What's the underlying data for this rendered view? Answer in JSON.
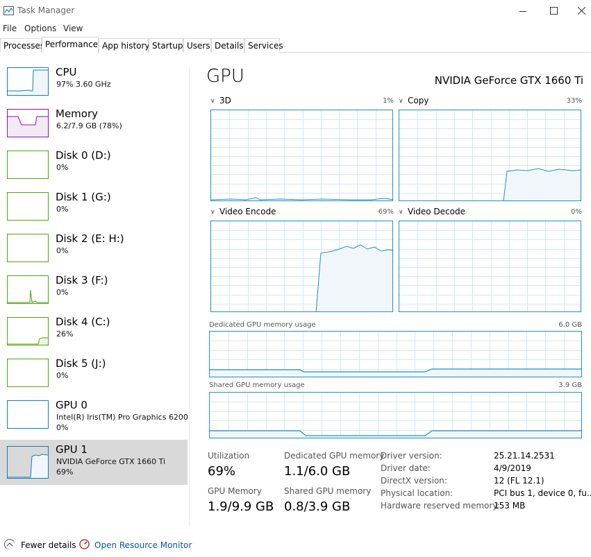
{
  "window": {
    "title": "Task Manager",
    "controls": {
      "minimize": "minimize",
      "maximize": "maximize",
      "close": "close"
    }
  },
  "menu": [
    "File",
    "Options",
    "View"
  ],
  "tabs": [
    "Processes",
    "Performance",
    "App history",
    "Startup",
    "Users",
    "Details",
    "Services"
  ],
  "active_tab": "Performance",
  "sidebar": [
    {
      "title": "CPU",
      "sub1": "97%  3.60 GHz",
      "sub2": "",
      "color": "#117dbb",
      "fill": "#f1f6fa"
    },
    {
      "title": "Memory",
      "sub1": "6.2/7.9 GB (78%)",
      "sub2": "",
      "color": "#8b12ae",
      "fill": "#f4eaf6"
    },
    {
      "title": "Disk 0 (D:)",
      "sub1": "0%",
      "sub2": "",
      "color": "#4da60c",
      "fill": "#eff7e6"
    },
    {
      "title": "Disk 1 (G:)",
      "sub1": "0%",
      "sub2": "",
      "color": "#4da60c",
      "fill": "#eff7e6"
    },
    {
      "title": "Disk 2 (E: H:)",
      "sub1": "0%",
      "sub2": "",
      "color": "#4da60c",
      "fill": "#eff7e6"
    },
    {
      "title": "Disk 3 (F:)",
      "sub1": "0%",
      "sub2": "",
      "color": "#4da60c",
      "fill": "#eff7e6"
    },
    {
      "title": "Disk 4 (C:)",
      "sub1": "26%",
      "sub2": "",
      "color": "#4da60c",
      "fill": "#eff7e6"
    },
    {
      "title": "Disk 5 (J:)",
      "sub1": "0%",
      "sub2": "",
      "color": "#4da60c",
      "fill": "#eff7e6"
    },
    {
      "title": "GPU 0",
      "sub1": "Intel(R) Iris(TM) Pro Graphics 6200",
      "sub2": "0%",
      "color": "#117dbb",
      "fill": "#f1f6fa"
    },
    {
      "title": "GPU 1",
      "sub1": "NVIDIA GeForce GTX 1660 Ti",
      "sub2": "69%",
      "color": "#117dbb",
      "fill": "#f1f6fa"
    }
  ],
  "selected_sidebar_index": 9,
  "main": {
    "heading": "GPU",
    "model": "NVIDIA GeForce GTX 1660 Ti",
    "engines": [
      {
        "name": "3D",
        "percent": "1%"
      },
      {
        "name": "Copy",
        "percent": "33%"
      },
      {
        "name": "Video Encode",
        "percent": "69%"
      },
      {
        "name": "Video Decode",
        "percent": "0%"
      }
    ],
    "dedicated_label": "Dedicated GPU memory usage",
    "dedicated_max": "6.0 GB",
    "shared_label": "Shared GPU memory usage",
    "shared_max": "3.9 GB"
  },
  "stats": {
    "utilization_label": "Utilization",
    "utilization_value": "69%",
    "dedicated_label": "Dedicated GPU memory",
    "dedicated_value": "1.1/6.0 GB",
    "gpu_memory_label": "GPU Memory",
    "gpu_memory_value": "1.9/9.9 GB",
    "shared_label": "Shared GPU memory",
    "shared_value": "0.8/3.9 GB"
  },
  "info": [
    {
      "label": "Driver version:",
      "value": "25.21.14.2531"
    },
    {
      "label": "Driver date:",
      "value": "4/9/2019"
    },
    {
      "label": "DirectX version:",
      "value": "12 (FL 12.1)"
    },
    {
      "label": "Physical location:",
      "value": "PCI bus 1, device 0, fu..."
    },
    {
      "label": "Hardware reserved memory:",
      "value": "153 MB"
    }
  ],
  "footer": {
    "fewer_details": "Fewer details",
    "open_resource_monitor": "Open Resource Monitor"
  },
  "colors": {
    "gpu_line": "#1e8fc8",
    "gpu_fill": "#f1f6fa",
    "grid": "#d6e8f3",
    "link": "#0b57a8"
  }
}
